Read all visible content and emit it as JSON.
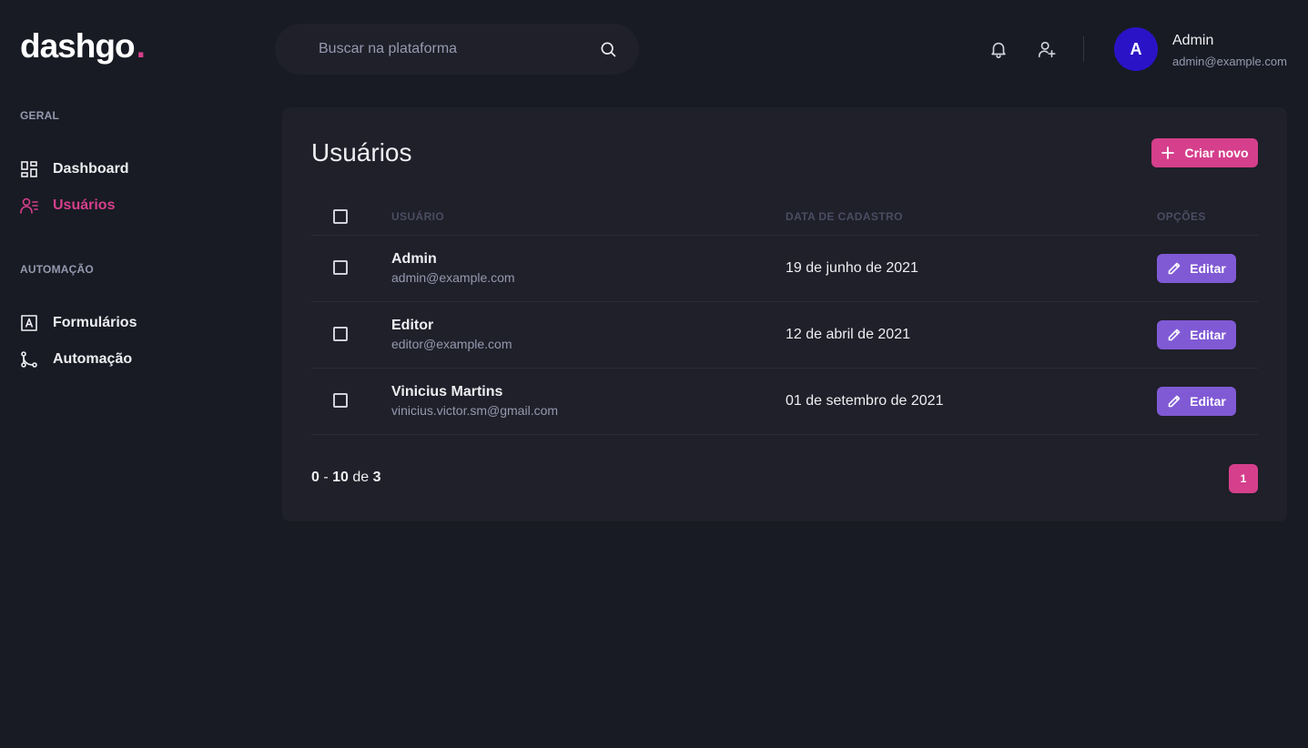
{
  "logo": {
    "text": "dashgo",
    "dot": "."
  },
  "search": {
    "placeholder": "Buscar na plataforma",
    "value": ""
  },
  "profile": {
    "name": "Admin",
    "email": "admin@example.com",
    "avatar_initial": "A"
  },
  "sidebar": {
    "sections": [
      {
        "title": "GERAL",
        "items": [
          {
            "label": "Dashboard",
            "icon": "dashboard-icon"
          },
          {
            "label": "Usuários",
            "icon": "users-icon",
            "active": true
          }
        ]
      },
      {
        "title": "AUTOMAÇÃO",
        "items": [
          {
            "label": "Formulários",
            "icon": "forms-icon"
          },
          {
            "label": "Automação",
            "icon": "automation-icon"
          }
        ]
      }
    ]
  },
  "main": {
    "title": "Usuários",
    "create_button": "Criar novo",
    "columns": [
      "USUÁRIO",
      "DATA DE CADASTRO",
      "OPÇÕES"
    ],
    "edit_label": "Editar",
    "users": [
      {
        "name": "Admin",
        "email": "admin@example.com",
        "created": "19 de junho de 2021"
      },
      {
        "name": "Editor",
        "email": "editor@example.com",
        "created": "12 de abril de 2021"
      },
      {
        "name": "Vinicius Martins",
        "email": "vinicius.victor.sm@gmail.com",
        "created": "01 de setembro de 2021"
      }
    ],
    "pagination": {
      "start": "0",
      "sep": "-",
      "end": "10",
      "of": "de",
      "total": "3",
      "current_page": "1"
    }
  },
  "colors": {
    "accent": "#d53f8c",
    "edit": "#805ad5",
    "avatar": "#2a13c7",
    "background": "#181b23",
    "panel": "#1f2029"
  }
}
